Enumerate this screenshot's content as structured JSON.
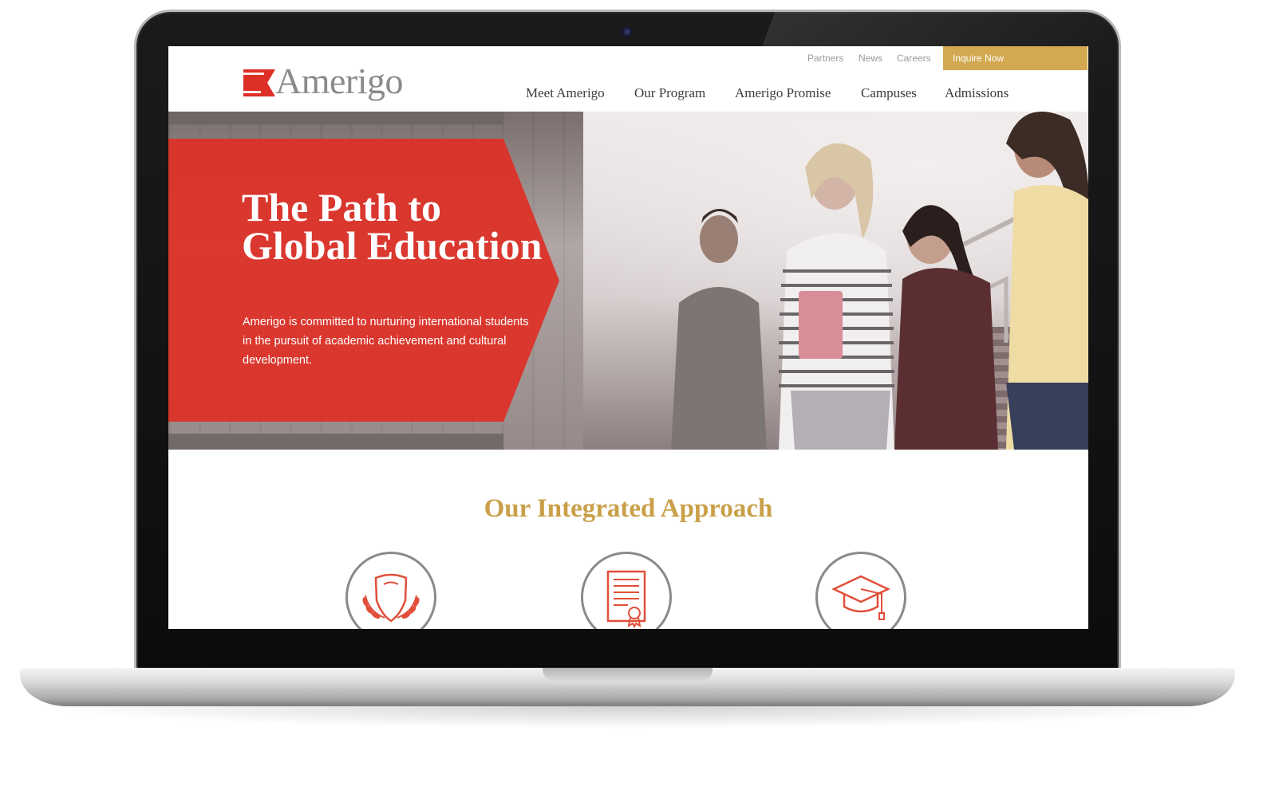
{
  "utility_nav": {
    "links": [
      "Partners",
      "News",
      "Careers"
    ],
    "cta_label": "Inquire Now"
  },
  "brand": {
    "name": "Amerigo"
  },
  "main_nav": {
    "items": [
      "Meet Amerigo",
      "Our Program",
      "Amerigo Promise",
      "Campuses",
      "Admissions"
    ]
  },
  "hero": {
    "title": "The Path to Global Education",
    "body": "Amerigo is committed to nurturing international students in the pursuit of academic achievement and cultural development."
  },
  "approach": {
    "title": "Our Integrated Approach",
    "icons": [
      "shield-laurel-icon",
      "certificate-icon",
      "graduation-cap-icon"
    ]
  },
  "colors": {
    "accent_red": "#de2f26",
    "accent_gold": "#d2a851",
    "heading_gold": "#c9a049"
  }
}
